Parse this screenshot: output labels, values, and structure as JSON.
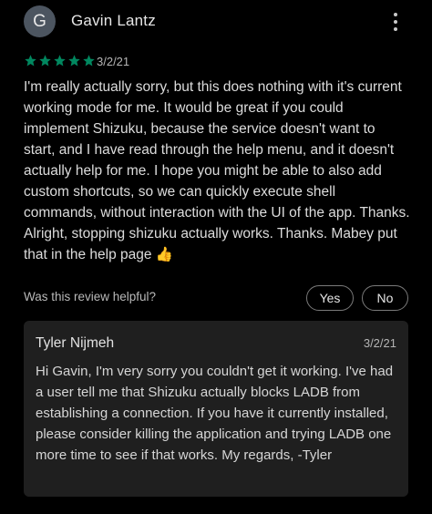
{
  "review": {
    "avatar_letter": "G",
    "author": "Gavin Lantz",
    "rating": 5,
    "rating_max": 5,
    "date": "3/2/21",
    "text": "I'm really actually sorry, but this does nothing with it's current working mode for me. It would be great if you could implement Shizuku, because the service doesn't want to start, and I have read through the help menu, and it doesn't actually help for me. I hope you might be able to also add custom shortcuts, so we can quickly execute shell commands, without interaction with the UI of the app. Thanks. Alright, stopping shizuku actually works. Thanks. Mabey put that in the help page 👍",
    "helpful_question": "Was this review helpful?",
    "yes_label": "Yes",
    "no_label": "No"
  },
  "reply": {
    "author": "Tyler Nijmeh",
    "date": "3/2/21",
    "text": "Hi Gavin, I'm very sorry you couldn't get it working. I've had a user tell me that Shizuku actually blocks LADB from establishing a connection. If you have it currently installed, please consider killing the application and trying LADB one more time to see if that works. My regards, -Tyler"
  },
  "colors": {
    "background": "#000000",
    "star": "#01875f",
    "avatar_bg": "#4c5560",
    "reply_bg": "#1f1f1f"
  },
  "icons": {
    "menu": "more-vert-icon",
    "star": "star-icon",
    "thumbs_up": "thumbs-up-emoji"
  }
}
